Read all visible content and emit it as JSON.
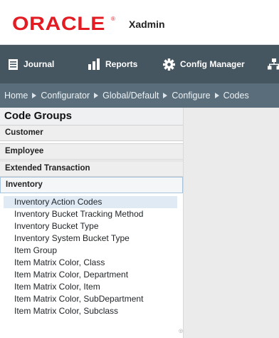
{
  "brand": {
    "logo_text": "ORACLE",
    "registered_mark": "®",
    "app_name": "Xadmin",
    "logo_color": "#e31b23"
  },
  "navbar": {
    "items": [
      {
        "label": "Journal",
        "icon": "journal-icon"
      },
      {
        "label": "Reports",
        "icon": "reports-bar-chart-icon"
      },
      {
        "label": "Config Manager",
        "icon": "gear-icon"
      },
      {
        "label": "",
        "icon": "sitemap-icon"
      }
    ],
    "background": "#465661"
  },
  "breadcrumb": {
    "items": [
      "Home",
      "Configurator",
      "Global/Default",
      "Configure",
      "Codes"
    ],
    "background": "#5a6d7b"
  },
  "code_groups": {
    "title": "Code Groups",
    "groups": [
      "Customer",
      "Employee",
      "Extended Transaction",
      "Inventory"
    ],
    "active_group": "Inventory",
    "items": [
      "Inventory Action Codes",
      "Inventory Bucket Tracking Method",
      "Inventory Bucket Type",
      "Inventory System Bucket Type",
      "Item Group",
      "Item Matrix Color, Class",
      "Item Matrix Color, Department",
      "Item Matrix Color, Item",
      "Item Matrix Color, SubDepartment",
      "Item Matrix Color, Subclass"
    ],
    "selected_item": "Inventory Action Codes",
    "selected_color": "#dfeaf5"
  }
}
